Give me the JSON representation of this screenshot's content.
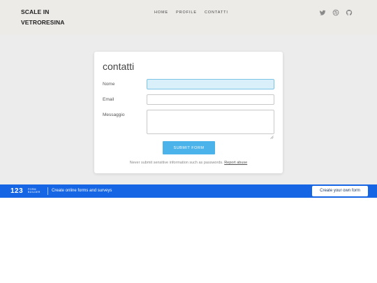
{
  "header": {
    "brand_line1": "SCALE IN",
    "brand_line2": "VETRORESINA",
    "nav": [
      {
        "label": "HOME"
      },
      {
        "label": "PROFILE"
      },
      {
        "label": "CONTATTI"
      }
    ],
    "social_icons": [
      "twitter-icon",
      "dribbble-icon",
      "github-icon"
    ]
  },
  "form": {
    "title": "contatti",
    "fields": {
      "name_label": "Nome",
      "name_value": "",
      "email_label": "Email",
      "email_value": "",
      "message_label": "Messaggio",
      "message_value": ""
    },
    "submit_label": "SUBMIT FORM",
    "notice_text": "Never submit sensitive information such as passwords.",
    "report_link": "Report abuse"
  },
  "promo": {
    "logo_number": "123",
    "logo_line1": "FORM",
    "logo_line2": "BUILDER",
    "tagline": "Create online forms and surveys",
    "cta_label": "Create your own form"
  },
  "colors": {
    "header_bg": "#ecebe8",
    "page_bg": "#ececec",
    "submit_button": "#4cb3ea",
    "active_field_bg": "#d9f0fb",
    "promo_bar": "#1565e4"
  }
}
